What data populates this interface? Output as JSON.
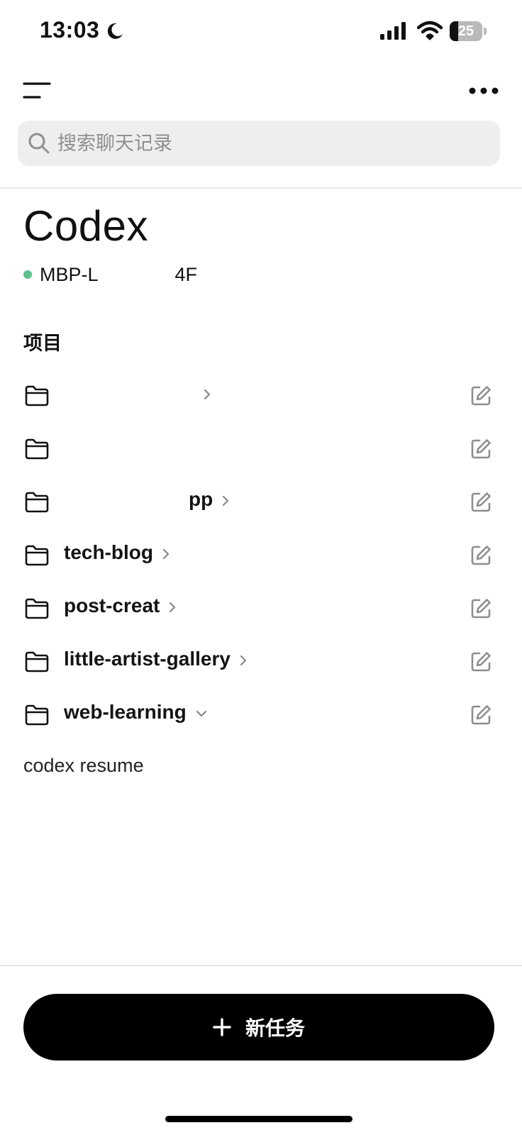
{
  "status_bar": {
    "time": "13:03",
    "battery": "25",
    "battery_level": 0.25
  },
  "search": {
    "placeholder": "搜索聊天记录",
    "value": ""
  },
  "header": {
    "title": "Codex",
    "device_name": "MBP-L    4F",
    "device_status_color": "#5fbf8f"
  },
  "projects": {
    "section_label": "项目",
    "items": [
      {
        "name": "",
        "expanded": false
      },
      {
        "name": "",
        "expanded": false
      },
      {
        "name": "pp",
        "expanded": false
      },
      {
        "name": "tech-blog",
        "expanded": false
      },
      {
        "name": "post-creat",
        "expanded": false
      },
      {
        "name": "little-artist-gallery",
        "expanded": false
      },
      {
        "name": "web-learning",
        "expanded": true
      }
    ],
    "expanded_items": [
      "codex resume"
    ]
  },
  "footer": {
    "new_task_label": "新任务"
  },
  "icons": {
    "menu": "menu-icon",
    "more": "more-icon",
    "search": "search-icon",
    "folder": "folder-icon",
    "edit": "edit-icon",
    "chevron_right": "chevron-right-icon",
    "chevron_down": "chevron-down-icon",
    "plus": "plus-icon"
  }
}
